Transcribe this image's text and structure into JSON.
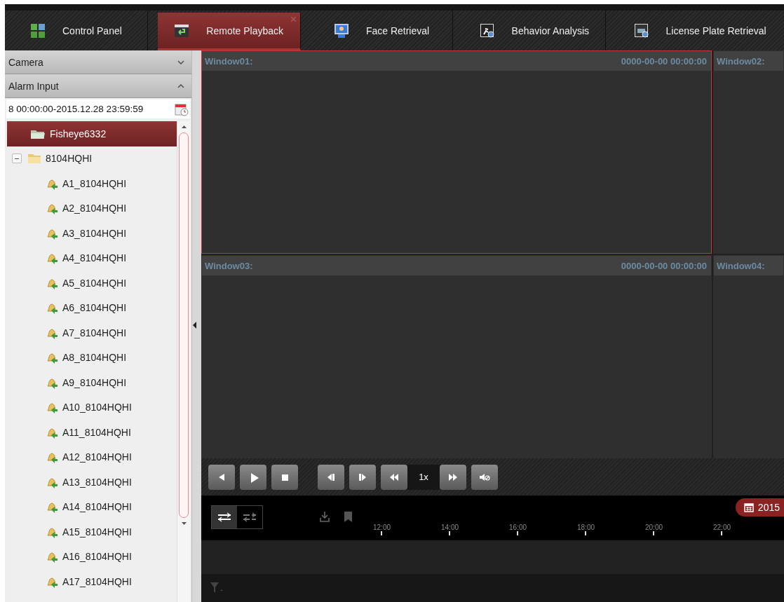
{
  "tabs": [
    {
      "label": "Control Panel",
      "kind": "grid",
      "selected": false
    },
    {
      "label": "Remote Playback",
      "kind": "playback",
      "selected": true
    },
    {
      "label": "Face Retrieval",
      "kind": "face",
      "selected": false
    },
    {
      "label": "Behavior Analysis",
      "kind": "behavior",
      "selected": false
    },
    {
      "label": "License Plate Retrieval",
      "kind": "plate",
      "selected": false
    }
  ],
  "sidebar": {
    "sections": [
      {
        "label": "Camera",
        "expanded": false
      },
      {
        "label": "Alarm Input",
        "expanded": true
      }
    ],
    "time_range": "8 00:00:00-2015.12.28 23:59:59",
    "tree": [
      {
        "label": "Fisheye6332",
        "kind": "folder",
        "selected": true
      },
      {
        "label": "8104HQHI",
        "kind": "device",
        "selected": false,
        "expanded": true,
        "children": [
          {
            "label": "A1_8104HQHI",
            "kind": "alarm",
            "selected": false
          },
          {
            "label": "A2_8104HQHI",
            "kind": "alarm",
            "selected": false
          },
          {
            "label": "A3_8104HQHI",
            "kind": "alarm",
            "selected": false
          },
          {
            "label": "A4_8104HQHI",
            "kind": "alarm",
            "selected": false
          },
          {
            "label": "A5_8104HQHI",
            "kind": "alarm",
            "selected": false
          },
          {
            "label": "A6_8104HQHI",
            "kind": "alarm",
            "selected": false
          },
          {
            "label": "A7_8104HQHI",
            "kind": "alarm",
            "selected": false
          },
          {
            "label": "A8_8104HQHI",
            "kind": "alarm",
            "selected": false
          },
          {
            "label": "A9_8104HQHI",
            "kind": "alarm",
            "selected": false
          },
          {
            "label": "A10_8104HQHI",
            "kind": "alarm",
            "selected": false
          },
          {
            "label": "A11_8104HQHI",
            "kind": "alarm",
            "selected": false
          },
          {
            "label": "A12_8104HQHI",
            "kind": "alarm",
            "selected": false
          },
          {
            "label": "A13_8104HQHI",
            "kind": "alarm",
            "selected": false
          },
          {
            "label": "A14_8104HQHI",
            "kind": "alarm",
            "selected": false
          },
          {
            "label": "A15_8104HQHI",
            "kind": "alarm",
            "selected": false
          },
          {
            "label": "A16_8104HQHI",
            "kind": "alarm",
            "selected": false
          },
          {
            "label": "A17_8104HQHI",
            "kind": "alarm",
            "selected": false
          }
        ]
      }
    ]
  },
  "windows": [
    {
      "title": "Window01:",
      "time": "0000-00-00 00:00:00",
      "selected": true
    },
    {
      "title": "Window02:",
      "selected": false
    },
    {
      "title": "Window03:",
      "time": "0000-00-00 00:00:00",
      "selected": false
    },
    {
      "title": "Window04:",
      "selected": false
    }
  ],
  "playback_controls": [
    {
      "kind": "reverse"
    },
    {
      "kind": "play"
    },
    {
      "kind": "stop"
    },
    {
      "kind": "gap"
    },
    {
      "kind": "frame-back"
    },
    {
      "kind": "frame-forward"
    },
    {
      "kind": "slow"
    },
    {
      "kind": "speed",
      "label": "1x"
    },
    {
      "kind": "fast"
    },
    {
      "kind": "mute"
    }
  ],
  "timeline": {
    "modes": [
      {
        "kind": "sync",
        "selected": true
      },
      {
        "kind": "async",
        "selected": false
      }
    ],
    "date_badge": "2015",
    "ticks": [
      "12:00",
      "14:00",
      "16:00",
      "18:00",
      "20:00",
      "22:00"
    ]
  }
}
